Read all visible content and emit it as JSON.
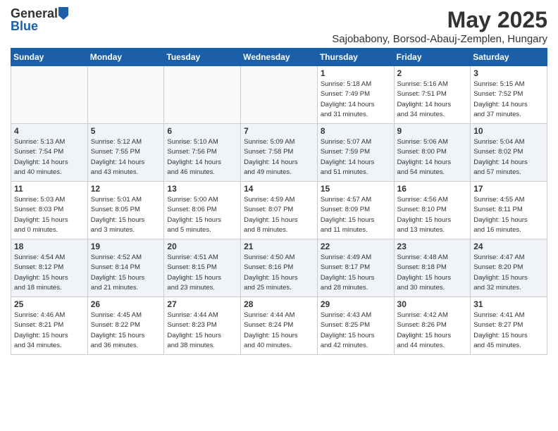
{
  "header": {
    "logo_general": "General",
    "logo_blue": "Blue",
    "month_title": "May 2025",
    "subtitle": "Sajobabony, Borsod-Abauj-Zemplen, Hungary"
  },
  "weekdays": [
    "Sunday",
    "Monday",
    "Tuesday",
    "Wednesday",
    "Thursday",
    "Friday",
    "Saturday"
  ],
  "weeks": [
    [
      {
        "day": "",
        "info": ""
      },
      {
        "day": "",
        "info": ""
      },
      {
        "day": "",
        "info": ""
      },
      {
        "day": "",
        "info": ""
      },
      {
        "day": "1",
        "info": "Sunrise: 5:18 AM\nSunset: 7:49 PM\nDaylight: 14 hours\nand 31 minutes."
      },
      {
        "day": "2",
        "info": "Sunrise: 5:16 AM\nSunset: 7:51 PM\nDaylight: 14 hours\nand 34 minutes."
      },
      {
        "day": "3",
        "info": "Sunrise: 5:15 AM\nSunset: 7:52 PM\nDaylight: 14 hours\nand 37 minutes."
      }
    ],
    [
      {
        "day": "4",
        "info": "Sunrise: 5:13 AM\nSunset: 7:54 PM\nDaylight: 14 hours\nand 40 minutes."
      },
      {
        "day": "5",
        "info": "Sunrise: 5:12 AM\nSunset: 7:55 PM\nDaylight: 14 hours\nand 43 minutes."
      },
      {
        "day": "6",
        "info": "Sunrise: 5:10 AM\nSunset: 7:56 PM\nDaylight: 14 hours\nand 46 minutes."
      },
      {
        "day": "7",
        "info": "Sunrise: 5:09 AM\nSunset: 7:58 PM\nDaylight: 14 hours\nand 49 minutes."
      },
      {
        "day": "8",
        "info": "Sunrise: 5:07 AM\nSunset: 7:59 PM\nDaylight: 14 hours\nand 51 minutes."
      },
      {
        "day": "9",
        "info": "Sunrise: 5:06 AM\nSunset: 8:00 PM\nDaylight: 14 hours\nand 54 minutes."
      },
      {
        "day": "10",
        "info": "Sunrise: 5:04 AM\nSunset: 8:02 PM\nDaylight: 14 hours\nand 57 minutes."
      }
    ],
    [
      {
        "day": "11",
        "info": "Sunrise: 5:03 AM\nSunset: 8:03 PM\nDaylight: 15 hours\nand 0 minutes."
      },
      {
        "day": "12",
        "info": "Sunrise: 5:01 AM\nSunset: 8:05 PM\nDaylight: 15 hours\nand 3 minutes."
      },
      {
        "day": "13",
        "info": "Sunrise: 5:00 AM\nSunset: 8:06 PM\nDaylight: 15 hours\nand 5 minutes."
      },
      {
        "day": "14",
        "info": "Sunrise: 4:59 AM\nSunset: 8:07 PM\nDaylight: 15 hours\nand 8 minutes."
      },
      {
        "day": "15",
        "info": "Sunrise: 4:57 AM\nSunset: 8:09 PM\nDaylight: 15 hours\nand 11 minutes."
      },
      {
        "day": "16",
        "info": "Sunrise: 4:56 AM\nSunset: 8:10 PM\nDaylight: 15 hours\nand 13 minutes."
      },
      {
        "day": "17",
        "info": "Sunrise: 4:55 AM\nSunset: 8:11 PM\nDaylight: 15 hours\nand 16 minutes."
      }
    ],
    [
      {
        "day": "18",
        "info": "Sunrise: 4:54 AM\nSunset: 8:12 PM\nDaylight: 15 hours\nand 18 minutes."
      },
      {
        "day": "19",
        "info": "Sunrise: 4:52 AM\nSunset: 8:14 PM\nDaylight: 15 hours\nand 21 minutes."
      },
      {
        "day": "20",
        "info": "Sunrise: 4:51 AM\nSunset: 8:15 PM\nDaylight: 15 hours\nand 23 minutes."
      },
      {
        "day": "21",
        "info": "Sunrise: 4:50 AM\nSunset: 8:16 PM\nDaylight: 15 hours\nand 25 minutes."
      },
      {
        "day": "22",
        "info": "Sunrise: 4:49 AM\nSunset: 8:17 PM\nDaylight: 15 hours\nand 28 minutes."
      },
      {
        "day": "23",
        "info": "Sunrise: 4:48 AM\nSunset: 8:18 PM\nDaylight: 15 hours\nand 30 minutes."
      },
      {
        "day": "24",
        "info": "Sunrise: 4:47 AM\nSunset: 8:20 PM\nDaylight: 15 hours\nand 32 minutes."
      }
    ],
    [
      {
        "day": "25",
        "info": "Sunrise: 4:46 AM\nSunset: 8:21 PM\nDaylight: 15 hours\nand 34 minutes."
      },
      {
        "day": "26",
        "info": "Sunrise: 4:45 AM\nSunset: 8:22 PM\nDaylight: 15 hours\nand 36 minutes."
      },
      {
        "day": "27",
        "info": "Sunrise: 4:44 AM\nSunset: 8:23 PM\nDaylight: 15 hours\nand 38 minutes."
      },
      {
        "day": "28",
        "info": "Sunrise: 4:44 AM\nSunset: 8:24 PM\nDaylight: 15 hours\nand 40 minutes."
      },
      {
        "day": "29",
        "info": "Sunrise: 4:43 AM\nSunset: 8:25 PM\nDaylight: 15 hours\nand 42 minutes."
      },
      {
        "day": "30",
        "info": "Sunrise: 4:42 AM\nSunset: 8:26 PM\nDaylight: 15 hours\nand 44 minutes."
      },
      {
        "day": "31",
        "info": "Sunrise: 4:41 AM\nSunset: 8:27 PM\nDaylight: 15 hours\nand 45 minutes."
      }
    ]
  ]
}
